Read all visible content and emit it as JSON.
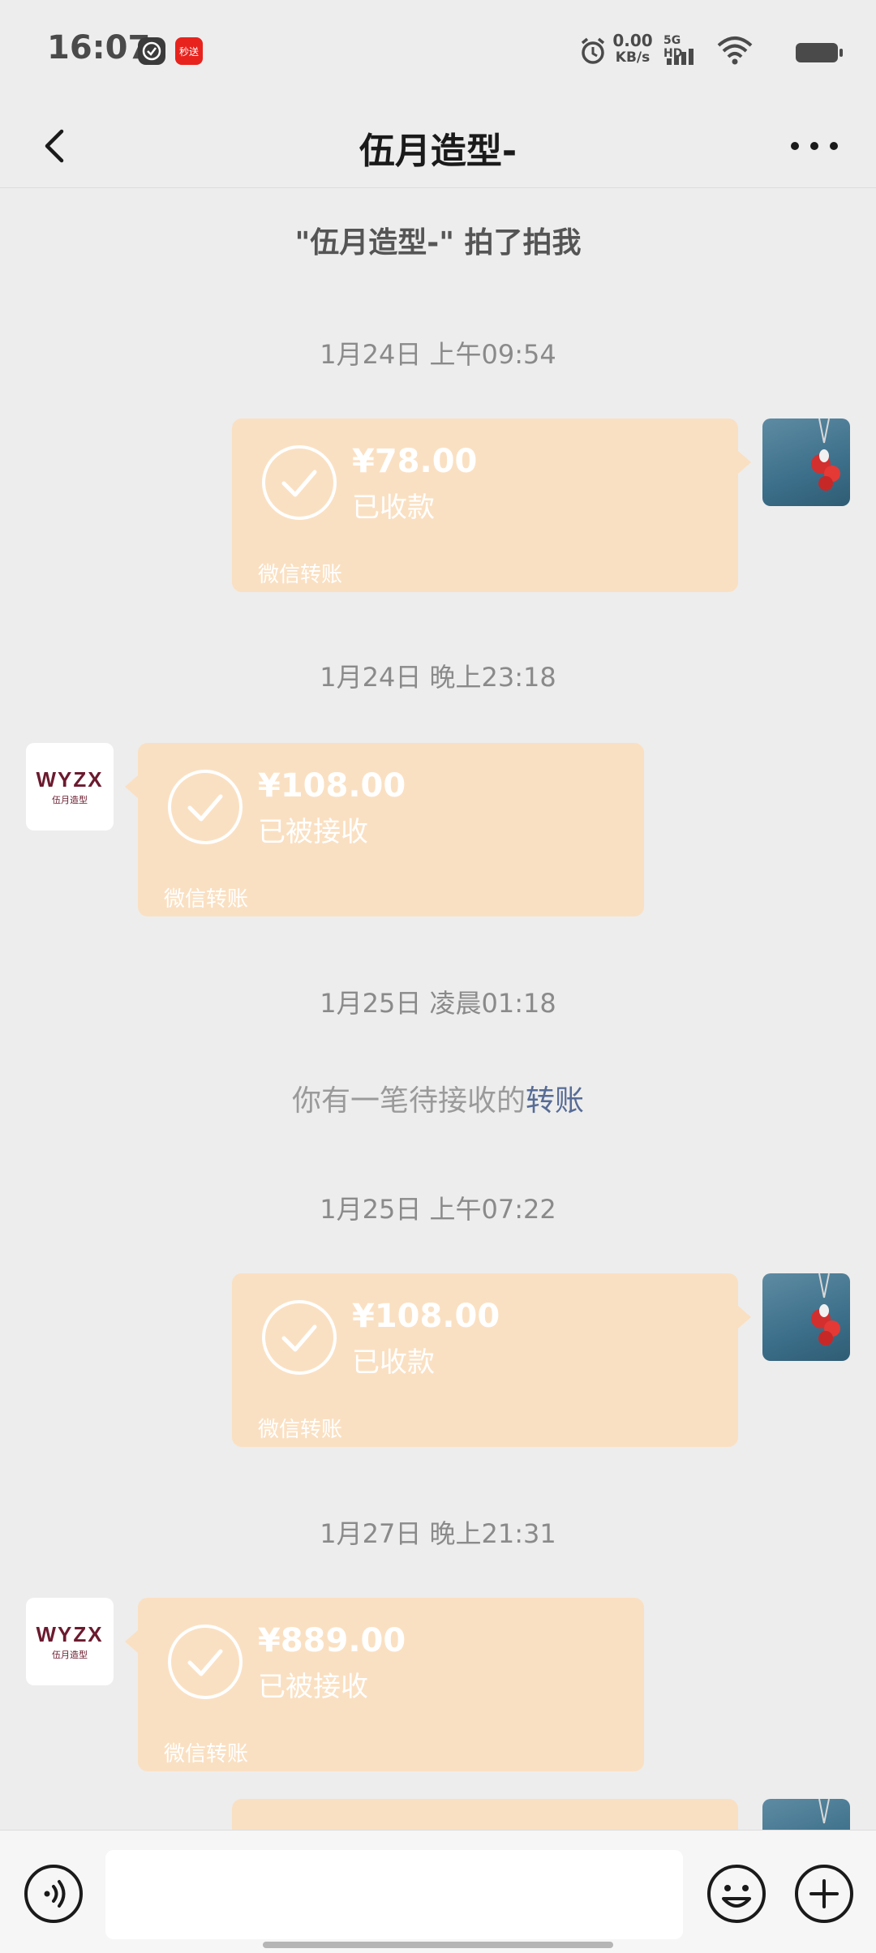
{
  "status_bar": {
    "time": "16:07",
    "app_badge": "秒送",
    "net_speed_value": "0.00",
    "net_speed_unit": "KB/s",
    "signal_label": "5G HD"
  },
  "header": {
    "title": "伍月造型-"
  },
  "chat": {
    "system_message": "\"伍月造型-\" 拍了拍我",
    "messages": [
      {
        "timestamp": "1月24日 上午09:54",
        "side": "right",
        "amount": "¥78.00",
        "status": "已收款",
        "footer": "微信转账"
      },
      {
        "timestamp": "1月24日 晚上23:18",
        "side": "left",
        "amount": "¥108.00",
        "status": "已被接收",
        "footer": "微信转账"
      },
      {
        "timestamp": "1月25日 凌晨01:18"
      },
      {
        "timestamp": "1月25日 上午07:22",
        "side": "right",
        "amount": "¥108.00",
        "status": "已收款",
        "footer": "微信转账"
      },
      {
        "timestamp": "1月27日 晚上21:31",
        "side": "left",
        "amount": "¥889.00",
        "status": "已被接收",
        "footer": "微信转账"
      }
    ],
    "notice_prefix": "你有一笔待接收的",
    "notice_link": "转账"
  },
  "shop_avatar": {
    "logo_text": "WYZX",
    "logo_sub": "伍月造型"
  },
  "colors": {
    "bubble": "#fae0c2",
    "background": "#ededed",
    "link": "#576b95"
  }
}
